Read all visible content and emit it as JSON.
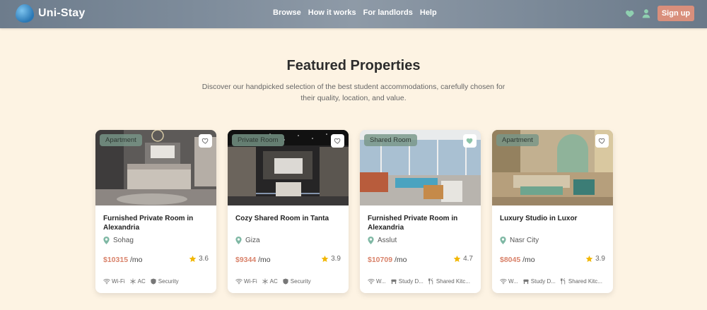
{
  "header": {
    "brand": "Uni-Stay",
    "nav": [
      "Browse",
      "How it works",
      "For landlords",
      "Help"
    ],
    "signup_label": "Sign up"
  },
  "section": {
    "title": "Featured Properties",
    "subtitle": "Discover our handpicked selection of the best student accommodations, carefully chosen for their quality, location, and value."
  },
  "cards": [
    {
      "badge": "Apartment",
      "favorited": false,
      "title": "Furnished Private Room in Alexandria",
      "location": "Sohag",
      "price": "$10315",
      "per": "/mo",
      "rating": "3.6",
      "amenities": [
        {
          "icon": "wifi-icon",
          "label": "Wi-Fi"
        },
        {
          "icon": "snowflake-icon",
          "label": "AC"
        },
        {
          "icon": "shield-icon",
          "label": "Security"
        }
      ]
    },
    {
      "badge": "Private Room",
      "favorited": false,
      "title": "Cozy Shared Room in Tanta",
      "location": "Giza",
      "price": "$9344",
      "per": "/mo",
      "rating": "3.9",
      "amenities": [
        {
          "icon": "wifi-icon",
          "label": "Wi-Fi"
        },
        {
          "icon": "snowflake-icon",
          "label": "AC"
        },
        {
          "icon": "shield-icon",
          "label": "Security"
        }
      ]
    },
    {
      "badge": "Shared Room",
      "favorited": true,
      "title": "Furnished Private Room in Alexandria",
      "location": "Asslut",
      "price": "$10709",
      "per": "/mo",
      "rating": "4.7",
      "amenities": [
        {
          "icon": "wifi-icon",
          "label": "W..."
        },
        {
          "icon": "desk-icon",
          "label": "Study D..."
        },
        {
          "icon": "kitchen-icon",
          "label": "Shared Kitc..."
        }
      ]
    },
    {
      "badge": "Apartment",
      "favorited": false,
      "title": "Luxury Studio in Luxor",
      "location": "Nasr City",
      "price": "$8045",
      "per": "/mo",
      "rating": "3.9",
      "amenities": [
        {
          "icon": "wifi-icon",
          "label": "W..."
        },
        {
          "icon": "desk-icon",
          "label": "Study D..."
        },
        {
          "icon": "kitchen-icon",
          "label": "Shared Kitc..."
        }
      ]
    }
  ],
  "colors": {
    "accent": "#d98f7c",
    "price": "#d9826a",
    "star": "#f2b705",
    "pin": "#7fb8a4",
    "favorite": "#8cc4a8"
  }
}
